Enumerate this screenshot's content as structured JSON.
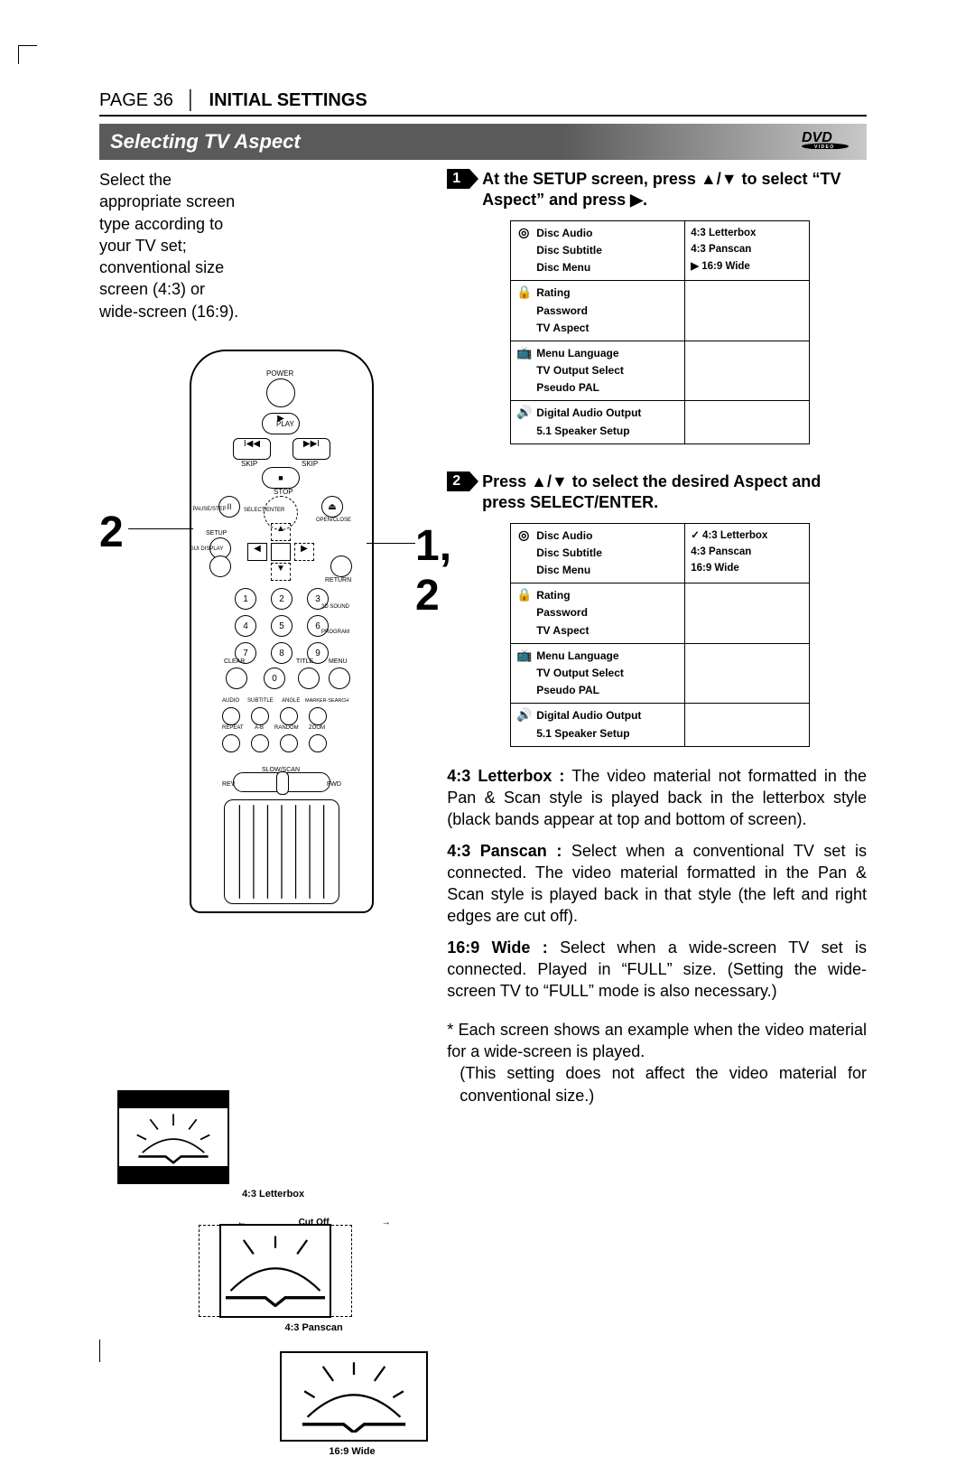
{
  "header": {
    "page_label": "PAGE 36",
    "section_label": "INITIAL SETTINGS"
  },
  "title_bar": {
    "title": "Selecting TV Aspect",
    "logo": "DVD"
  },
  "intro": "Select the appropriate screen type according to your TV set; conventional size screen (4:3) or wide-screen (16:9).",
  "callouts": {
    "left": "2",
    "right": "1, 2"
  },
  "remote_labels": {
    "power": "POWER",
    "play": "PLAY",
    "skip_l": "SKIP",
    "skip_r": "SKIP",
    "stop": "STOP",
    "pause": "PAUSE/STEP",
    "select": "SELECT/ENTER",
    "open": "OPEN/CLOSE",
    "setup": "SETUP",
    "gui": "GUI DISPLAY",
    "return": "RETURN",
    "clear": "CLEAR",
    "title": "TITLE",
    "menu": "MENU",
    "sound3d": "3D SOUND",
    "program": "PROGRAM",
    "audio": "AUDIO",
    "subtitle": "SUBTITLE",
    "angle": "ANGLE",
    "marker": "MARKER-SEARCH",
    "repeat": "REPEAT",
    "ab": "A-B",
    "random": "RANDOM",
    "zoom": "ZOOM",
    "slow": "SLOW/SCAN",
    "rev": "REV",
    "fwd": "FWD"
  },
  "steps": {
    "s1": {
      "num": "1",
      "text_a": "At the SETUP screen, press ",
      "text_b": " to select “TV Aspect” and press ",
      "text_c": "."
    },
    "s2": {
      "num": "2",
      "text_a": "Press ",
      "text_b": " to select the desired Aspect and press SELECT/ENTER."
    }
  },
  "osd_menu": {
    "g1": [
      "Disc Audio",
      "Disc Subtitle",
      "Disc Menu"
    ],
    "g2": [
      "Rating",
      "Password",
      "TV Aspect"
    ],
    "g3": [
      "Menu Language",
      "TV Output Select",
      "Pseudo PAL"
    ],
    "g4": [
      "Digital Audio Output",
      "5.1 Speaker Setup"
    ],
    "opts": {
      "a": "4:3 Letterbox",
      "b": "4:3 Panscan",
      "c": "16:9 Wide"
    }
  },
  "descriptions": {
    "letterbox_label": "4:3 Letterbox :",
    "letterbox_text": " The video material not formatted in the Pan & Scan style is played back in the letterbox style (black bands appear at top and bottom of screen).",
    "panscan_label": "4:3 Panscan :",
    "panscan_text": " Select when a conventional TV set is connected. The video material formatted in the Pan & Scan style is played back in that style (the left and right edges are cut off).",
    "wide_label": "16:9 Wide :",
    "wide_text": " Select when a wide-screen TV set is connected. Played in “FULL” size. (Setting the wide-screen TV to “FULL” mode is also necessary.)",
    "note_a": "* Each screen shows an example when the video material for a wide-screen is played.",
    "note_b": "(This setting does not affect the video material for conventional size.)"
  },
  "thumbs": {
    "lb": "4:3 Letterbox",
    "ps": "4:3 Panscan",
    "wd": "16:9 Wide",
    "cut": "Cut Off"
  }
}
